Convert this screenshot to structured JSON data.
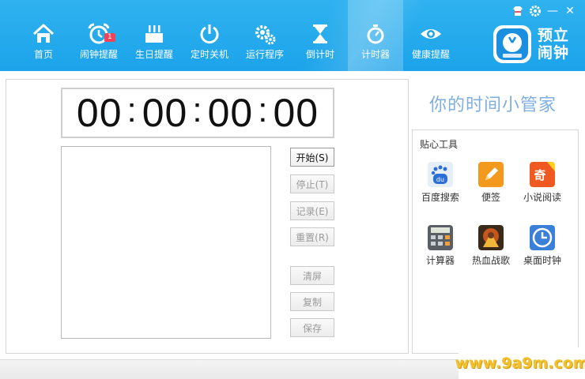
{
  "window_controls": {
    "skin": "skin-icon",
    "settings": "gear-icon",
    "minimize": "—",
    "close": "✕"
  },
  "nav": [
    {
      "id": "home",
      "label": "首页",
      "icon": "house-icon"
    },
    {
      "id": "alarm",
      "label": "闹钟提醒",
      "icon": "alarm-clock-icon",
      "badge": "1"
    },
    {
      "id": "birthday",
      "label": "生日提醒",
      "icon": "birthday-cake-icon"
    },
    {
      "id": "shutdown",
      "label": "定时关机",
      "icon": "power-icon"
    },
    {
      "id": "run",
      "label": "运行程序",
      "icon": "gears-icon"
    },
    {
      "id": "countdown",
      "label": "倒计时",
      "icon": "hourglass-icon"
    },
    {
      "id": "stopwatch",
      "label": "计时器",
      "icon": "stopwatch-icon",
      "active": true
    },
    {
      "id": "health",
      "label": "健康提醒",
      "icon": "eye-icon"
    }
  ],
  "brand": {
    "line1": "预立",
    "line2": "闹钟"
  },
  "timer": {
    "h": "00",
    "m": "00",
    "s": "00",
    "cs": "00"
  },
  "buttons": {
    "start": "开始(S)",
    "stop": "停止(T)",
    "record": "记录(E)",
    "reset": "重置(R)",
    "clear": "清屏",
    "copy": "复制",
    "save": "保存"
  },
  "slogan": "你的时间小管家",
  "tools": {
    "title": "贴心工具",
    "items": [
      {
        "label": "百度搜索",
        "icon": "baidu-icon"
      },
      {
        "label": "便签",
        "icon": "notepad-icon"
      },
      {
        "label": "小说阅读",
        "icon": "novel-icon"
      },
      {
        "label": "计算器",
        "icon": "calculator-icon"
      },
      {
        "label": "热血战歌",
        "icon": "game-icon"
      },
      {
        "label": "桌面时钟",
        "icon": "desktop-clock-icon"
      }
    ]
  },
  "watermark": "www.9a9m.com"
}
